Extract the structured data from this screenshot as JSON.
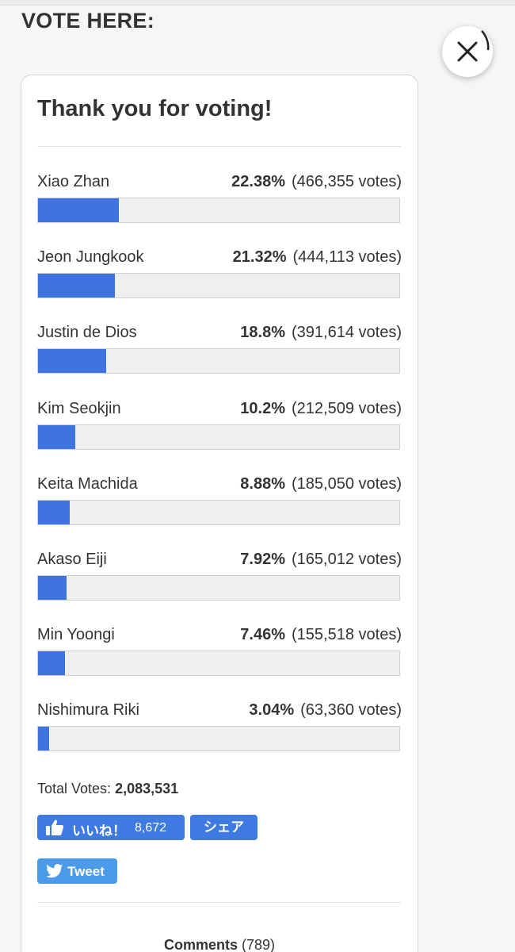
{
  "header": {
    "title": "VOTE HERE:"
  },
  "icons": {
    "close": "close-icon",
    "like": "thumbs-up-icon",
    "tweet": "twitter-bird-icon"
  },
  "colors": {
    "bar": "#3f73df",
    "facebook_button": "#3f7ae3",
    "tweet_button": "#4b9be8"
  },
  "poll": {
    "title": "Thank you for voting!",
    "results": [
      {
        "name": "Xiao Zhan",
        "percent": "22.38%",
        "votes": "(466,355 votes)",
        "share": 22.38
      },
      {
        "name": "Jeon Jungkook",
        "percent": "21.32%",
        "votes": "(444,113 votes)",
        "share": 21.32
      },
      {
        "name": "Justin de Dios",
        "percent": "18.8%",
        "votes": "(391,614 votes)",
        "share": 18.8
      },
      {
        "name": "Kim Seokjin",
        "percent": "10.2%",
        "votes": "(212,509 votes)",
        "share": 10.2
      },
      {
        "name": "Keita Machida",
        "percent": "8.88%",
        "votes": "(185,050 votes)",
        "share": 8.88
      },
      {
        "name": "Akaso Eiji",
        "percent": "7.92%",
        "votes": "(165,012 votes)",
        "share": 7.92
      },
      {
        "name": "Min Yoongi",
        "percent": "7.46%",
        "votes": "(155,518 votes)",
        "share": 7.46
      },
      {
        "name": "Nishimura Riki",
        "percent": "3.04%",
        "votes": "(63,360 votes)",
        "share": 3.04
      }
    ],
    "total_label": "Total Votes:",
    "total_value": "2,083,531"
  },
  "social": {
    "like_label": "いいね！",
    "like_count": "8,672",
    "share_label": "シェア",
    "tweet_label": "Tweet"
  },
  "comments": {
    "label": "Comments",
    "count": "(789)"
  }
}
